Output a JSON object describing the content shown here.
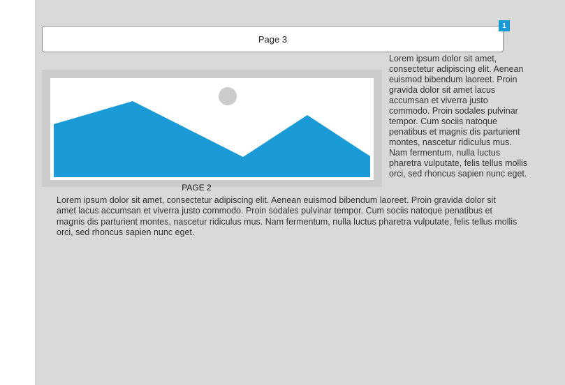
{
  "page_bar": {
    "label": "Page 3"
  },
  "badge": {
    "count": "1"
  },
  "image": {
    "icon": "landscape-placeholder-icon",
    "colors": {
      "mountain": "#1a9ad6",
      "sun": "#cccccc",
      "frame": "#cccccc"
    }
  },
  "caption": "PAGE 2",
  "side_text": "Lorem ipsum dolor sit amet, consectetur adipiscing elit. Aenean euismod bibendum laoreet. Proin gravida dolor sit amet lacus accumsan et viverra justo commodo. Proin sodales pulvinar tempor. Cum sociis natoque penatibus et magnis dis parturient montes, nascetur ridiculus mus. Nam fermentum, nulla luctus pharetra vulputate, felis tellus mollis orci, sed rhoncus sapien nunc eget.",
  "body_text": "Lorem ipsum dolor sit amet, consectetur adipiscing elit. Aenean euismod bibendum laoreet. Proin gravida dolor sit amet lacus accumsan et viverra justo commodo. Proin sodales pulvinar tempor. Cum sociis natoque penatibus et magnis dis parturient montes, nascetur ridiculus mus. Nam fermentum, nulla luctus pharetra vulputate, felis tellus mollis orci, sed rhoncus sapien nunc eget.",
  "colors": {
    "accent": "#1a9ad6",
    "canvas": "#d9d9d9"
  }
}
